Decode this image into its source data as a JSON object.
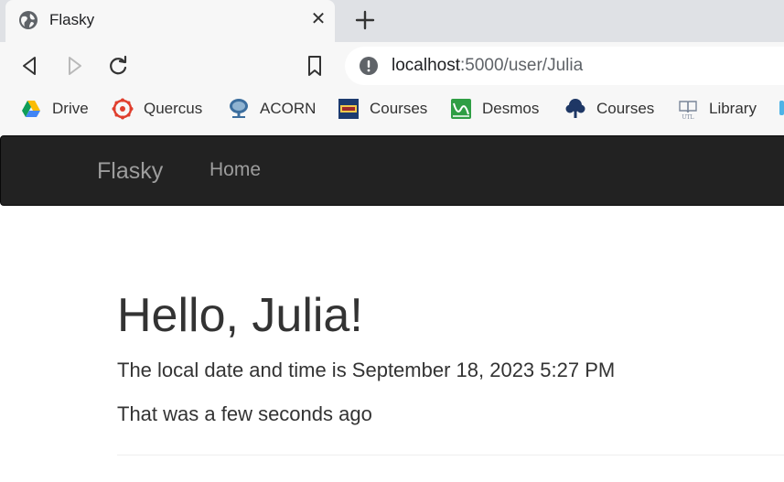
{
  "browser": {
    "tab": {
      "title": "Flasky",
      "close": "✕"
    },
    "new_tab": "+",
    "address": {
      "host": "localhost",
      "rest": ":5000/user/Julia"
    }
  },
  "bookmarks": [
    {
      "label": "Drive",
      "icon": "google-drive-icon"
    },
    {
      "label": "Quercus",
      "icon": "quercus-icon"
    },
    {
      "label": "ACORN",
      "icon": "acorn-icon"
    },
    {
      "label": "Courses",
      "icon": "skule-courses-icon"
    },
    {
      "label": "Desmos",
      "icon": "desmos-icon"
    },
    {
      "label": "Courses",
      "icon": "courses-tree-icon"
    },
    {
      "label": "Library",
      "icon": "utl-library-icon"
    }
  ],
  "navbar": {
    "brand": "Flasky",
    "home": "Home"
  },
  "page": {
    "greeting": "Hello, Julia!",
    "local_time": "The local date and time is September 18, 2023 5:27 PM",
    "relative_time": "That was a few seconds ago"
  },
  "colors": {
    "navbar_bg": "#222222",
    "navbar_text": "#9d9d9d",
    "tabstrip": "#dfe1e5",
    "toolbar": "#f7f7f7"
  }
}
